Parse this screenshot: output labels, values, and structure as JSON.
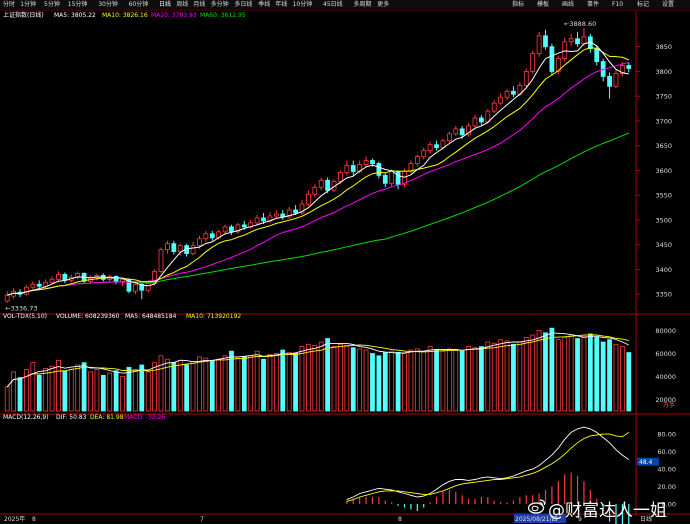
{
  "toolbar": {
    "tabs": [
      "分时",
      "1分钟",
      "5分钟",
      "15分钟",
      "30分钟",
      "60分钟",
      "日线",
      "周线",
      "月线",
      "多分钟",
      "多日线",
      "季线",
      "年线",
      "10分钟",
      "45日线",
      "多周期",
      "更多"
    ],
    "active_tab": "日线",
    "right": [
      "指标",
      "模板",
      "画线",
      "事件",
      "F10",
      "标记",
      "设置"
    ]
  },
  "price_panel": {
    "title": "上证指数(日线)",
    "ma5": "MA5: 3805.22",
    "ma10": "MA10: 3826.16",
    "ma20": "MA20: 3783.93",
    "ma60": "MA60: 3612.95",
    "high_label": "3888.60",
    "low_label": "3336.73"
  },
  "volume_panel": {
    "title": "VOL-TDX(5,10)",
    "volume": "VOLUME: 608239360",
    "ma5": "MA5: 648485184",
    "ma10": "MA10: 713920192",
    "unit": "万手"
  },
  "macd_panel": {
    "title": "MACD(12,26,9)",
    "dif": "DIF: 50.83",
    "dea": "DEA: 81.98",
    "macd": "MACD: -32.26",
    "marker": "48.4"
  },
  "date_axis": {
    "labels": [
      "2025年",
      "8",
      "",
      "7",
      "",
      "8",
      "2025/08/21/四",
      "9"
    ],
    "right_label": "日线"
  },
  "watermark": "@财富达人一姐",
  "colors": {
    "up": "#ff3c3c",
    "down": "#54ffff",
    "ma5": "#ffffff",
    "ma10": "#ffff00",
    "ma20": "#ff00ff",
    "ma60": "#00dd00",
    "axis": "#b00000"
  },
  "chart_data": {
    "type": "candlestick",
    "price_axis": {
      "ticks": [
        3850,
        3800,
        3750,
        3700,
        3650,
        3600,
        3550,
        3500,
        3450,
        3400,
        3350
      ],
      "ylim": [
        3316,
        3906
      ]
    },
    "volume_axis": {
      "ticks": [
        "80000",
        "60000",
        "40000",
        "20000"
      ],
      "ylim": [
        10000,
        90000
      ]
    },
    "macd_axis": {
      "ticks": [
        "80.00",
        "60.00",
        "40.00",
        "20.00",
        "0.00"
      ],
      "ylim": [
        -8,
        95
      ]
    },
    "candles": [
      {
        "o": 3336,
        "c": 3348,
        "h": 3356,
        "l": 3333,
        "v": 31000
      },
      {
        "o": 3346,
        "c": 3356,
        "h": 3362,
        "l": 3341,
        "v": 44000
      },
      {
        "o": 3354,
        "c": 3350,
        "h": 3360,
        "l": 3344,
        "v": 39000
      },
      {
        "o": 3350,
        "c": 3364,
        "h": 3368,
        "l": 3347,
        "v": 46000
      },
      {
        "o": 3364,
        "c": 3370,
        "h": 3376,
        "l": 3358,
        "v": 52000
      },
      {
        "o": 3370,
        "c": 3366,
        "h": 3378,
        "l": 3360,
        "v": 41000
      },
      {
        "o": 3366,
        "c": 3374,
        "h": 3380,
        "l": 3362,
        "v": 47000
      },
      {
        "o": 3374,
        "c": 3380,
        "h": 3386,
        "l": 3370,
        "v": 49000
      },
      {
        "o": 3380,
        "c": 3390,
        "h": 3396,
        "l": 3375,
        "v": 54000
      },
      {
        "o": 3390,
        "c": 3378,
        "h": 3394,
        "l": 3372,
        "v": 45000
      },
      {
        "o": 3378,
        "c": 3384,
        "h": 3390,
        "l": 3374,
        "v": 46000
      },
      {
        "o": 3384,
        "c": 3392,
        "h": 3396,
        "l": 3380,
        "v": 50000
      },
      {
        "o": 3392,
        "c": 3376,
        "h": 3394,
        "l": 3372,
        "v": 52000
      },
      {
        "o": 3376,
        "c": 3384,
        "h": 3388,
        "l": 3372,
        "v": 44000
      },
      {
        "o": 3384,
        "c": 3388,
        "h": 3392,
        "l": 3378,
        "v": 46000
      },
      {
        "o": 3388,
        "c": 3380,
        "h": 3392,
        "l": 3376,
        "v": 41000
      },
      {
        "o": 3380,
        "c": 3386,
        "h": 3390,
        "l": 3376,
        "v": 43000
      },
      {
        "o": 3386,
        "c": 3376,
        "h": 3388,
        "l": 3370,
        "v": 45000
      },
      {
        "o": 3376,
        "c": 3380,
        "h": 3384,
        "l": 3366,
        "v": 40000
      },
      {
        "o": 3380,
        "c": 3356,
        "h": 3382,
        "l": 3352,
        "v": 48000
      },
      {
        "o": 3356,
        "c": 3370,
        "h": 3374,
        "l": 3350,
        "v": 46000
      },
      {
        "o": 3370,
        "c": 3358,
        "h": 3374,
        "l": 3340,
        "v": 50000
      },
      {
        "o": 3358,
        "c": 3372,
        "h": 3378,
        "l": 3354,
        "v": 44000
      },
      {
        "o": 3372,
        "c": 3396,
        "h": 3400,
        "l": 3368,
        "v": 52000
      },
      {
        "o": 3396,
        "c": 3440,
        "h": 3444,
        "l": 3392,
        "v": 58000
      },
      {
        "o": 3440,
        "c": 3452,
        "h": 3458,
        "l": 3432,
        "v": 55000
      },
      {
        "o": 3452,
        "c": 3436,
        "h": 3458,
        "l": 3430,
        "v": 52000
      },
      {
        "o": 3436,
        "c": 3448,
        "h": 3452,
        "l": 3428,
        "v": 54000
      },
      {
        "o": 3448,
        "c": 3432,
        "h": 3452,
        "l": 3426,
        "v": 50000
      },
      {
        "o": 3432,
        "c": 3448,
        "h": 3456,
        "l": 3428,
        "v": 53000
      },
      {
        "o": 3448,
        "c": 3462,
        "h": 3468,
        "l": 3442,
        "v": 57000
      },
      {
        "o": 3462,
        "c": 3472,
        "h": 3478,
        "l": 3456,
        "v": 56000
      },
      {
        "o": 3472,
        "c": 3464,
        "h": 3478,
        "l": 3458,
        "v": 54000
      },
      {
        "o": 3464,
        "c": 3476,
        "h": 3480,
        "l": 3460,
        "v": 55000
      },
      {
        "o": 3476,
        "c": 3486,
        "h": 3490,
        "l": 3470,
        "v": 58000
      },
      {
        "o": 3486,
        "c": 3476,
        "h": 3490,
        "l": 3470,
        "v": 62000
      },
      {
        "o": 3476,
        "c": 3490,
        "h": 3494,
        "l": 3472,
        "v": 56000
      },
      {
        "o": 3490,
        "c": 3486,
        "h": 3498,
        "l": 3480,
        "v": 57000
      },
      {
        "o": 3486,
        "c": 3494,
        "h": 3500,
        "l": 3482,
        "v": 58000
      },
      {
        "o": 3494,
        "c": 3504,
        "h": 3510,
        "l": 3490,
        "v": 62000
      },
      {
        "o": 3504,
        "c": 3498,
        "h": 3514,
        "l": 3492,
        "v": 55000
      },
      {
        "o": 3498,
        "c": 3508,
        "h": 3516,
        "l": 3494,
        "v": 59000
      },
      {
        "o": 3508,
        "c": 3512,
        "h": 3520,
        "l": 3504,
        "v": 60000
      },
      {
        "o": 3512,
        "c": 3506,
        "h": 3520,
        "l": 3500,
        "v": 63000
      },
      {
        "o": 3506,
        "c": 3520,
        "h": 3526,
        "l": 3502,
        "v": 61000
      },
      {
        "o": 3520,
        "c": 3514,
        "h": 3530,
        "l": 3510,
        "v": 60000
      },
      {
        "o": 3514,
        "c": 3532,
        "h": 3540,
        "l": 3510,
        "v": 66000
      },
      {
        "o": 3532,
        "c": 3552,
        "h": 3560,
        "l": 3528,
        "v": 68000
      },
      {
        "o": 3552,
        "c": 3566,
        "h": 3572,
        "l": 3546,
        "v": 67000
      },
      {
        "o": 3566,
        "c": 3580,
        "h": 3586,
        "l": 3560,
        "v": 70000
      },
      {
        "o": 3580,
        "c": 3560,
        "h": 3586,
        "l": 3554,
        "v": 73000
      },
      {
        "o": 3560,
        "c": 3578,
        "h": 3582,
        "l": 3556,
        "v": 66000
      },
      {
        "o": 3578,
        "c": 3596,
        "h": 3600,
        "l": 3572,
        "v": 68000
      },
      {
        "o": 3596,
        "c": 3610,
        "h": 3620,
        "l": 3590,
        "v": 67000
      },
      {
        "o": 3610,
        "c": 3598,
        "h": 3620,
        "l": 3590,
        "v": 65000
      },
      {
        "o": 3598,
        "c": 3612,
        "h": 3620,
        "l": 3594,
        "v": 64000
      },
      {
        "o": 3612,
        "c": 3620,
        "h": 3628,
        "l": 3606,
        "v": 63000
      },
      {
        "o": 3620,
        "c": 3614,
        "h": 3624,
        "l": 3608,
        "v": 60000
      },
      {
        "o": 3614,
        "c": 3590,
        "h": 3618,
        "l": 3584,
        "v": 58000
      },
      {
        "o": 3590,
        "c": 3574,
        "h": 3596,
        "l": 3566,
        "v": 61000
      },
      {
        "o": 3574,
        "c": 3598,
        "h": 3602,
        "l": 3568,
        "v": 62000
      },
      {
        "o": 3598,
        "c": 3572,
        "h": 3600,
        "l": 3562,
        "v": 61000
      },
      {
        "o": 3572,
        "c": 3598,
        "h": 3604,
        "l": 3566,
        "v": 60000
      },
      {
        "o": 3598,
        "c": 3614,
        "h": 3620,
        "l": 3594,
        "v": 63000
      },
      {
        "o": 3614,
        "c": 3628,
        "h": 3632,
        "l": 3608,
        "v": 64000
      },
      {
        "o": 3628,
        "c": 3640,
        "h": 3646,
        "l": 3622,
        "v": 62000
      },
      {
        "o": 3640,
        "c": 3652,
        "h": 3658,
        "l": 3634,
        "v": 66000
      },
      {
        "o": 3652,
        "c": 3646,
        "h": 3660,
        "l": 3640,
        "v": 63000
      },
      {
        "o": 3646,
        "c": 3660,
        "h": 3664,
        "l": 3642,
        "v": 62000
      },
      {
        "o": 3660,
        "c": 3674,
        "h": 3678,
        "l": 3656,
        "v": 64000
      },
      {
        "o": 3674,
        "c": 3684,
        "h": 3690,
        "l": 3670,
        "v": 63000
      },
      {
        "o": 3684,
        "c": 3672,
        "h": 3690,
        "l": 3664,
        "v": 62000
      },
      {
        "o": 3672,
        "c": 3690,
        "h": 3696,
        "l": 3668,
        "v": 66000
      },
      {
        "o": 3690,
        "c": 3706,
        "h": 3712,
        "l": 3686,
        "v": 65000
      },
      {
        "o": 3706,
        "c": 3698,
        "h": 3712,
        "l": 3692,
        "v": 66000
      },
      {
        "o": 3698,
        "c": 3720,
        "h": 3724,
        "l": 3694,
        "v": 70000
      },
      {
        "o": 3720,
        "c": 3736,
        "h": 3742,
        "l": 3716,
        "v": 69000
      },
      {
        "o": 3736,
        "c": 3748,
        "h": 3756,
        "l": 3732,
        "v": 72000
      },
      {
        "o": 3748,
        "c": 3760,
        "h": 3764,
        "l": 3742,
        "v": 71000
      },
      {
        "o": 3760,
        "c": 3754,
        "h": 3770,
        "l": 3748,
        "v": 68000
      },
      {
        "o": 3754,
        "c": 3772,
        "h": 3778,
        "l": 3750,
        "v": 70000
      },
      {
        "o": 3772,
        "c": 3800,
        "h": 3806,
        "l": 3768,
        "v": 74000
      },
      {
        "o": 3800,
        "c": 3836,
        "h": 3842,
        "l": 3796,
        "v": 76000
      },
      {
        "o": 3836,
        "c": 3872,
        "h": 3880,
        "l": 3830,
        "v": 80000
      },
      {
        "o": 3872,
        "c": 3850,
        "h": 3884,
        "l": 3844,
        "v": 78000
      },
      {
        "o": 3850,
        "c": 3800,
        "h": 3856,
        "l": 3792,
        "v": 82000
      },
      {
        "o": 3800,
        "c": 3826,
        "h": 3832,
        "l": 3794,
        "v": 72000
      },
      {
        "o": 3826,
        "c": 3860,
        "h": 3868,
        "l": 3820,
        "v": 74000
      },
      {
        "o": 3860,
        "c": 3866,
        "h": 3876,
        "l": 3852,
        "v": 76000
      },
      {
        "o": 3866,
        "c": 3856,
        "h": 3880,
        "l": 3850,
        "v": 73000
      },
      {
        "o": 3856,
        "c": 3870,
        "h": 3888,
        "l": 3852,
        "v": 75000
      },
      {
        "o": 3870,
        "c": 3846,
        "h": 3876,
        "l": 3838,
        "v": 77000
      },
      {
        "o": 3846,
        "c": 3820,
        "h": 3852,
        "l": 3812,
        "v": 74000
      },
      {
        "o": 3820,
        "c": 3790,
        "h": 3826,
        "l": 3780,
        "v": 70000
      },
      {
        "o": 3790,
        "c": 3770,
        "h": 3798,
        "l": 3745,
        "v": 72000
      },
      {
        "o": 3770,
        "c": 3796,
        "h": 3804,
        "l": 3766,
        "v": 68000
      },
      {
        "o": 3796,
        "c": 3812,
        "h": 3820,
        "l": 3790,
        "v": 66000
      },
      {
        "o": 3812,
        "c": 3806,
        "h": 3818,
        "l": 3798,
        "v": 60800
      }
    ],
    "macd_points": [
      {
        "dif": 5,
        "dea": 3
      },
      {
        "dif": 8,
        "dea": 5
      },
      {
        "dif": 12,
        "dea": 8
      },
      {
        "dif": 14,
        "dea": 10
      },
      {
        "dif": 16,
        "dea": 12
      },
      {
        "dif": 18,
        "dea": 14
      },
      {
        "dif": 17,
        "dea": 15
      },
      {
        "dif": 16,
        "dea": 15
      },
      {
        "dif": 14,
        "dea": 15
      },
      {
        "dif": 12,
        "dea": 14
      },
      {
        "dif": 10,
        "dea": 13
      },
      {
        "dif": 8,
        "dea": 12
      },
      {
        "dif": 9,
        "dea": 11
      },
      {
        "dif": 12,
        "dea": 11
      },
      {
        "dif": 17,
        "dea": 13
      },
      {
        "dif": 22,
        "dea": 15
      },
      {
        "dif": 26,
        "dea": 18
      },
      {
        "dif": 28,
        "dea": 21
      },
      {
        "dif": 28,
        "dea": 23
      },
      {
        "dif": 27,
        "dea": 24
      },
      {
        "dif": 28,
        "dea": 25
      },
      {
        "dif": 30,
        "dea": 26
      },
      {
        "dif": 31,
        "dea": 27
      },
      {
        "dif": 30,
        "dea": 28
      },
      {
        "dif": 29,
        "dea": 28
      },
      {
        "dif": 30,
        "dea": 29
      },
      {
        "dif": 32,
        "dea": 30
      },
      {
        "dif": 35,
        "dea": 31
      },
      {
        "dif": 38,
        "dea": 33
      },
      {
        "dif": 40,
        "dea": 35
      },
      {
        "dif": 44,
        "dea": 38
      },
      {
        "dif": 50,
        "dea": 42
      },
      {
        "dif": 56,
        "dea": 46
      },
      {
        "dif": 64,
        "dea": 51
      },
      {
        "dif": 74,
        "dea": 57
      },
      {
        "dif": 82,
        "dea": 64
      },
      {
        "dif": 86,
        "dea": 70
      },
      {
        "dif": 88,
        "dea": 75
      },
      {
        "dif": 86,
        "dea": 78
      },
      {
        "dif": 82,
        "dea": 79
      },
      {
        "dif": 76,
        "dea": 80
      },
      {
        "dif": 70,
        "dea": 80
      },
      {
        "dif": 62,
        "dea": 78
      },
      {
        "dif": 56,
        "dea": 77
      },
      {
        "dif": 50.83,
        "dea": 81.98
      }
    ]
  }
}
